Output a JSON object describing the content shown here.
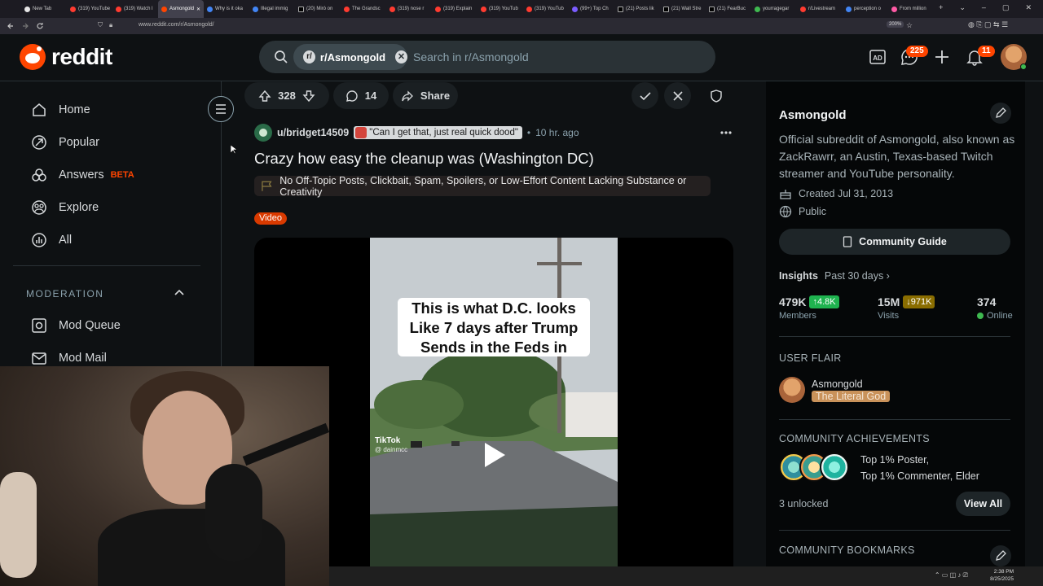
{
  "browser": {
    "tabs": [
      {
        "label": "New Tab",
        "fav": "y"
      },
      {
        "label": "(319) YouTube",
        "fav": ""
      },
      {
        "label": "(319) Watch l",
        "fav": ""
      },
      {
        "label": "Asmongold",
        "fav": "o",
        "active": true
      },
      {
        "label": "Why is it oka",
        "fav": "g"
      },
      {
        "label": "Illegal immig",
        "fav": "g"
      },
      {
        "label": "(20) Miró on",
        "fav": "x"
      },
      {
        "label": "The Grandsc",
        "fav": ""
      },
      {
        "label": "(319) nose r",
        "fav": ""
      },
      {
        "label": "(319) Explain",
        "fav": ""
      },
      {
        "label": "(319) YouTub",
        "fav": ""
      },
      {
        "label": "(319) YouTub",
        "fav": ""
      },
      {
        "label": "(99+) Top Ch",
        "fav": "p"
      },
      {
        "label": "(21) Posts lik",
        "fav": "x"
      },
      {
        "label": "(21) Wall Stre",
        "fav": "x"
      },
      {
        "label": "(21) FearBuc",
        "fav": "x"
      },
      {
        "label": "yourragegar",
        "fav": "t"
      },
      {
        "label": "r/Livestream",
        "fav": ""
      },
      {
        "label": "perception o",
        "fav": "g"
      },
      {
        "label": "From million",
        "fav": "m"
      }
    ],
    "url": "www.reddit.com/r/Asmongold/",
    "zoom": "200%"
  },
  "header": {
    "logo_text": "reddit",
    "search_chip": "r/Asmongold",
    "search_placeholder": "Search in r/Asmongold",
    "chat_badge": "225",
    "notif_badge": "11",
    "icons": [
      "ad-icon",
      "chat-icon",
      "plus-icon",
      "bell-icon"
    ]
  },
  "nav": {
    "items": [
      {
        "label": "Home",
        "icon": "home-icon"
      },
      {
        "label": "Popular",
        "icon": "popular-icon"
      },
      {
        "label": "Answers",
        "icon": "answers-icon",
        "beta": "BETA"
      },
      {
        "label": "Explore",
        "icon": "explore-icon"
      },
      {
        "label": "All",
        "icon": "all-icon"
      }
    ],
    "moderation_heading": "MODERATION",
    "mod_items": [
      {
        "label": "Mod Queue",
        "icon": "mod-queue-icon"
      },
      {
        "label": "Mod Mail",
        "icon": "mod-mail-icon"
      }
    ]
  },
  "post": {
    "score": "328",
    "comments": "14",
    "share_label": "Share",
    "author": "u/bridget14509",
    "author_flair": "\"Can I get that, just real quick dood\"",
    "time": "10 hr. ago",
    "title": "Crazy how easy the cleanup was (Washington DC)",
    "rule_banner": "No Off-Topic Posts, Clickbait, Spam, Spoilers, or Low-Effort Content Lacking Substance or Creativity",
    "post_flair": "Video",
    "video_caption_lines": [
      "This is what D.C. looks",
      "Like 7 days after Trump",
      "Sends in the Feds in"
    ],
    "watermark": "TikTok",
    "watermark_handle": "@ dainmcc"
  },
  "sidebar": {
    "sub_name": "Asmongold",
    "description": "Official subreddit of Asmongold, also known as ZackRawrr, an Austin, Texas-based Twitch streamer and YouTube personality.",
    "created": "Created Jul 31, 2013",
    "visibility": "Public",
    "guide_button": "Community Guide",
    "insights_label": "Insights",
    "insights_period": "Past 30 days",
    "stats": {
      "members_value": "479K",
      "members_delta": "4.8K",
      "members_label": "Members",
      "visits_value": "15M",
      "visits_delta": "971K",
      "visits_label": "Visits",
      "online_value": "374",
      "online_label": "Online"
    },
    "user_flair_heading": "USER FLAIR",
    "flair_user": "Asmongold",
    "flair_tag": "The Literal God",
    "achievements_heading": "COMMUNITY ACHIEVEMENTS",
    "achievement_line_1": "Top 1% Poster,",
    "achievement_line_2": "Top 1% Commenter, Elder",
    "unlocked": "3 unlocked",
    "view_all": "View All",
    "bookmarks_heading": "COMMUNITY BOOKMARKS"
  },
  "taskbar": {
    "time": "2:38 PM",
    "date": "8/25/2025"
  },
  "colors": {
    "brand": "#ff4500",
    "background": "#0e1113",
    "up": "#1fb34f",
    "down": "#8a6d00"
  }
}
